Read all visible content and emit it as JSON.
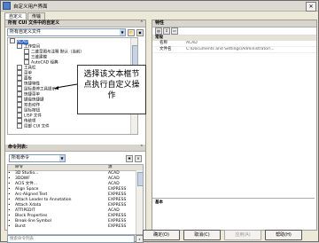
{
  "window": {
    "title": "自定义用户界面"
  },
  "tabs": [
    {
      "label": "自定义"
    },
    {
      "label": "传输"
    }
  ],
  "left": {
    "header": "所有 CUI 文件中的自定义",
    "file_combo": "所有自定义文件",
    "tree": [
      {
        "label": "ACAD",
        "level": 0,
        "selected": true
      },
      {
        "label": "工作空间",
        "level": 1
      },
      {
        "label": "二维草图与注释 默认（当前）",
        "level": 2
      },
      {
        "label": "三维建模",
        "level": 2
      },
      {
        "label": "AutoCAD 经典",
        "level": 2
      },
      {
        "label": "工具栏",
        "level": 1
      },
      {
        "label": "菜单",
        "level": 1
      },
      {
        "label": "面板",
        "level": 1
      },
      {
        "label": "快捷特性",
        "level": 1
      },
      {
        "label": "鼠标悬停工具提示",
        "level": 1
      },
      {
        "label": "快捷菜单",
        "level": 1
      },
      {
        "label": "键盘快捷键",
        "level": 1
      },
      {
        "label": "双击动作",
        "level": 1
      },
      {
        "label": "鼠标按钮",
        "level": 1
      },
      {
        "label": "LISP 文件",
        "level": 1
      },
      {
        "label": "传统项",
        "level": 1
      },
      {
        "label": "局部 CUI 文件",
        "level": 1
      }
    ],
    "commands_header": "命令列表:",
    "commands_filter": "所有命令",
    "table_headers": {
      "name": "命令",
      "source": "源"
    },
    "commands": [
      {
        "name": "3D Studio...",
        "source": "ACAD"
      },
      {
        "name": "3DDWF",
        "source": "ACAD"
      },
      {
        "name": "ACIS 文件...",
        "source": "ACAD"
      },
      {
        "name": "Align Space",
        "source": "EXPRESS"
      },
      {
        "name": "Arc-Aligned Text",
        "source": "EXPRESS"
      },
      {
        "name": "Attach Leader to Annotation",
        "source": "EXPRESS"
      },
      {
        "name": "Attach Xdata",
        "source": "EXPRESS"
      },
      {
        "name": "ATTIPEDIT",
        "source": "ACAD"
      },
      {
        "name": "Block Properties",
        "source": "EXPRESS"
      },
      {
        "name": "Break-line Symbol",
        "source": "EXPRESS"
      },
      {
        "name": "Burst",
        "source": "EXPRESS"
      }
    ],
    "search_placeholder": "搜索命令列表"
  },
  "callout": {
    "text": "选择该文本框节点执行自定义操作"
  },
  "right": {
    "header": "特性",
    "section_general": "常规",
    "props": [
      {
        "name": "名称",
        "value": "ACAD"
      },
      {
        "name": "文件名",
        "value": "C:\\Documents and Settings\\Administrator\\..."
      }
    ],
    "section_basic": "基本"
  },
  "buttons": {
    "ok": "确定(O)",
    "cancel": "取消(C)",
    "apply": "应用(A)",
    "help": "帮助(H)"
  }
}
